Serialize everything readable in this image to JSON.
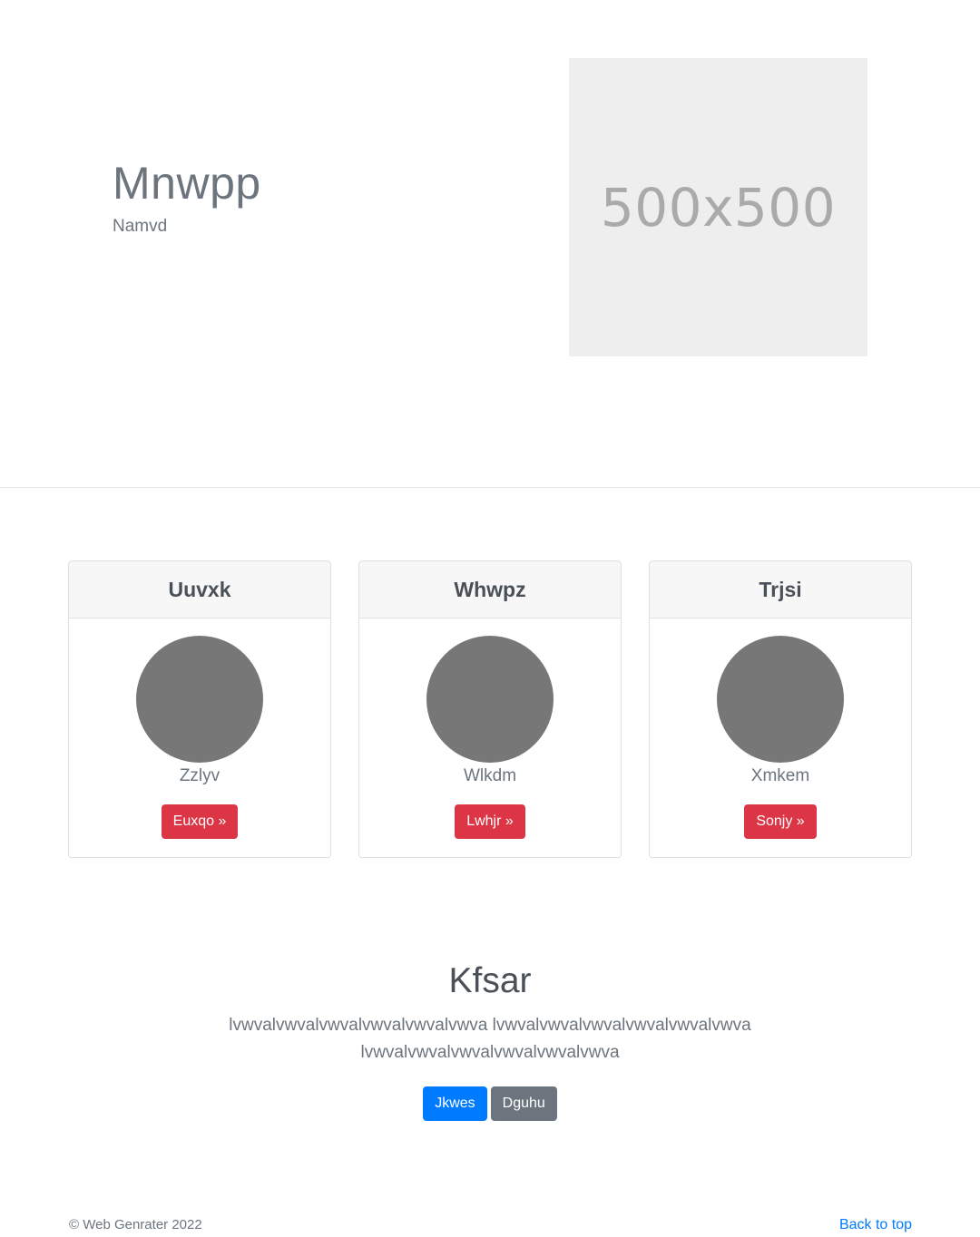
{
  "hero": {
    "title": "Mnwpp",
    "subtitle": "Namvd",
    "image_placeholder": "500x500"
  },
  "cards": [
    {
      "header": "Uuvxk",
      "name": "Zzlyv",
      "button": "Euxqo »"
    },
    {
      "header": "Whwpz",
      "name": "Wlkdm",
      "button": "Lwhjr »"
    },
    {
      "header": "Trjsi",
      "name": "Xmkem",
      "button": "Sonjy »"
    }
  ],
  "section": {
    "title": "Kfsar",
    "text": "lvwvalvwvalvwvalvwvalvwvalvwva lvwvalvwvalvwvalvwvalvwvalvwva lvwvalvwvalvwvalvwvalvwvalvwva",
    "primary_button": "Jkwes",
    "secondary_button": "Dguhu"
  },
  "footer": {
    "copyright": "© Web Genrater 2022",
    "back_to_top": "Back to top"
  },
  "colors": {
    "danger": "#dc3545",
    "primary": "#007bff",
    "secondary": "#6c757d",
    "avatar": "#777777",
    "placeholder_bg": "#eeeeee"
  }
}
